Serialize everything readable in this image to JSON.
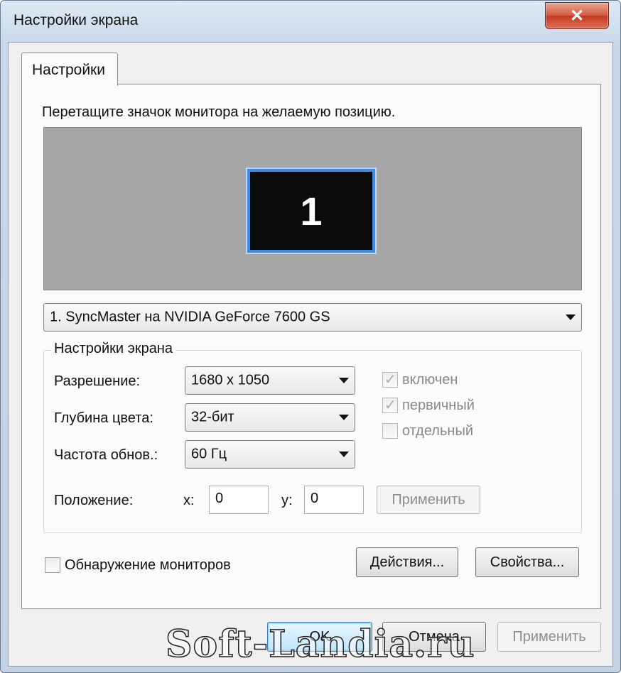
{
  "window": {
    "title": "Настройки экрана",
    "close_glyph": "✕"
  },
  "tabs": [
    {
      "label": "Настройки"
    }
  ],
  "instruction": "Перетащите значок монитора на желаемую позицию.",
  "monitor": {
    "number": "1"
  },
  "display_select": {
    "value": "1. SyncMaster на NVIDIA GeForce 7600 GS"
  },
  "screen_settings": {
    "group_label": "Настройки экрана",
    "resolution": {
      "label": "Разрешение:",
      "value": "1680 x 1050"
    },
    "color_depth": {
      "label": "Глубина цвета:",
      "value": "32-бит"
    },
    "refresh": {
      "label": "Частота обнов.:",
      "value": "60 Гц"
    },
    "position": {
      "label": "Положение:",
      "x_label": "x:",
      "x_value": "0",
      "y_label": "y:",
      "y_value": "0",
      "apply_label": "Применить"
    },
    "checkboxes": {
      "enabled": {
        "label": "включен",
        "checked": true
      },
      "primary": {
        "label": "первичный",
        "checked": true
      },
      "separate": {
        "label": "отдельный",
        "checked": false
      }
    }
  },
  "detect_monitors": {
    "label": "Обнаружение мониторов",
    "checked": false
  },
  "buttons": {
    "actions": "Действия...",
    "properties": "Свойства...",
    "ok": "OK",
    "cancel": "Отмена",
    "apply": "Применить"
  },
  "watermark": "Soft-Landia.ru"
}
